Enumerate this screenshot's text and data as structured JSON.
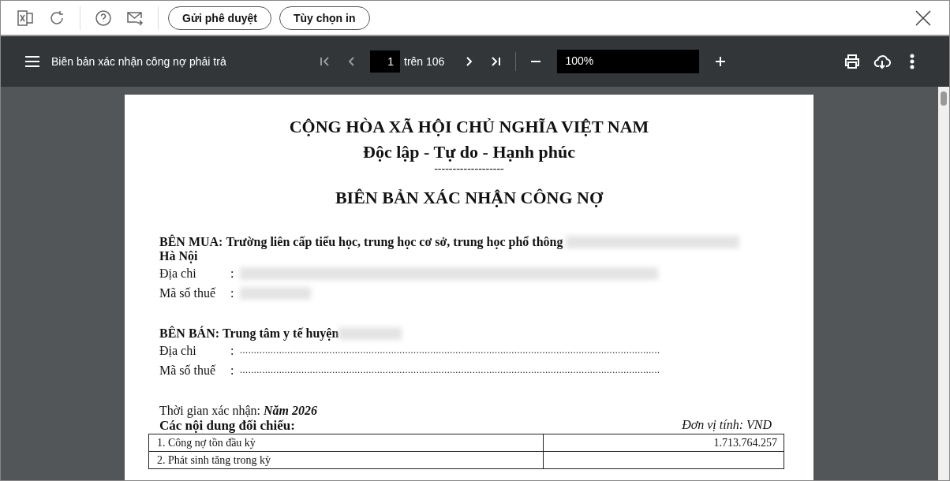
{
  "toolbar": {
    "buttons": [
      "Gửi phê duyệt",
      "Tùy chọn in"
    ]
  },
  "viewer": {
    "title": "Biên bản xác nhận công nợ phải trả",
    "page_number": "1",
    "page_total": "trên 106",
    "zoom": "100%"
  },
  "document": {
    "heading": [
      "CỘNG HÒA XÃ HỘI CHỦ NGHĨA VIỆT NAM",
      "Độc lập - Tự do - Hạnh phúc"
    ],
    "separator": "-------------------",
    "title": "BIÊN BẢN XÁC NHẬN CÔNG NỢ",
    "parties": [
      {
        "label": "BÊN MUA:",
        "name": "Trường liên cấp tiểu học, trung học cơ sở, trung học phổ thông",
        "name_redacted": true,
        "name_continued": "Hà Nội",
        "fields": [
          {
            "label": "Địa chi",
            "colon": ":",
            "kind": "redacted"
          },
          {
            "label": "Mã số thuế",
            "colon": ":",
            "kind": "redacted_short"
          }
        ]
      },
      {
        "label": "BÊN BÁN:",
        "name": "Trung tâm y tế huyện",
        "name_redacted": true,
        "fields": [
          {
            "label": "Địa chi",
            "colon": ":",
            "kind": "dots",
            "value": "......................................................................................................................................................"
          },
          {
            "label": "Mã số thuế",
            "colon": ":",
            "kind": "dots",
            "value": "......................................................................................................................................................"
          }
        ]
      }
    ],
    "period_label": "Thời gian xác nhận:",
    "period_value": "Năm 2026",
    "contents_heading": "Các nội dung đối chiếu:",
    "unit": "Đơn vị tính: VND",
    "rows": [
      {
        "label": "1. Công nợ tồn đầu kỳ",
        "value": "1.713.764.257"
      },
      {
        "label": "2. Phát sinh tăng trong kỳ",
        "value": ""
      }
    ]
  }
}
